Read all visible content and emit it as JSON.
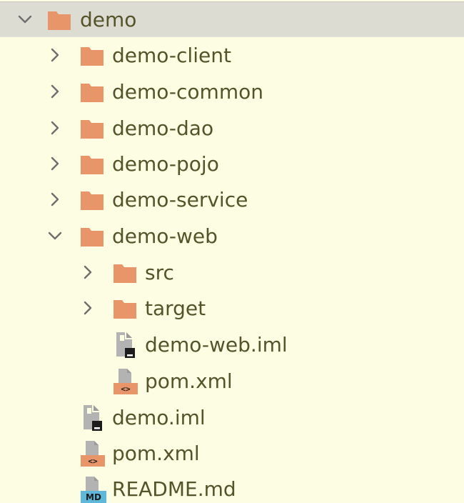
{
  "tree": {
    "root": {
      "label": "demo",
      "icon": "folder-icon",
      "state": "expanded",
      "selected": true
    },
    "modules": [
      {
        "label": "demo-client",
        "icon": "folder-icon",
        "state": "collapsed"
      },
      {
        "label": "demo-common",
        "icon": "folder-icon",
        "state": "collapsed"
      },
      {
        "label": "demo-dao",
        "icon": "folder-icon",
        "state": "collapsed"
      },
      {
        "label": "demo-pojo",
        "icon": "folder-icon",
        "state": "collapsed"
      },
      {
        "label": "demo-service",
        "icon": "folder-icon",
        "state": "collapsed"
      },
      {
        "label": "demo-web",
        "icon": "folder-icon",
        "state": "expanded"
      }
    ],
    "web_children": [
      {
        "label": "src",
        "icon": "folder-icon",
        "state": "collapsed"
      },
      {
        "label": "target",
        "icon": "folder-icon",
        "state": "collapsed"
      },
      {
        "label": "demo-web.iml",
        "icon": "iml-file-icon"
      },
      {
        "label": "pom.xml",
        "icon": "xml-file-icon"
      }
    ],
    "root_files": [
      {
        "label": "demo.iml",
        "icon": "iml-file-icon"
      },
      {
        "label": "pom.xml",
        "icon": "xml-file-icon"
      },
      {
        "label": "README.md",
        "icon": "markdown-file-icon",
        "badge": "MD"
      }
    ]
  },
  "colors": {
    "background": "#fdfde3",
    "selection": "#dcdcd2",
    "folder": "#e8956a",
    "text": "#54532a",
    "chevron": "#6e6e6e",
    "xml_badge": "#e8956a",
    "md_badge": "#5fb8d9"
  }
}
